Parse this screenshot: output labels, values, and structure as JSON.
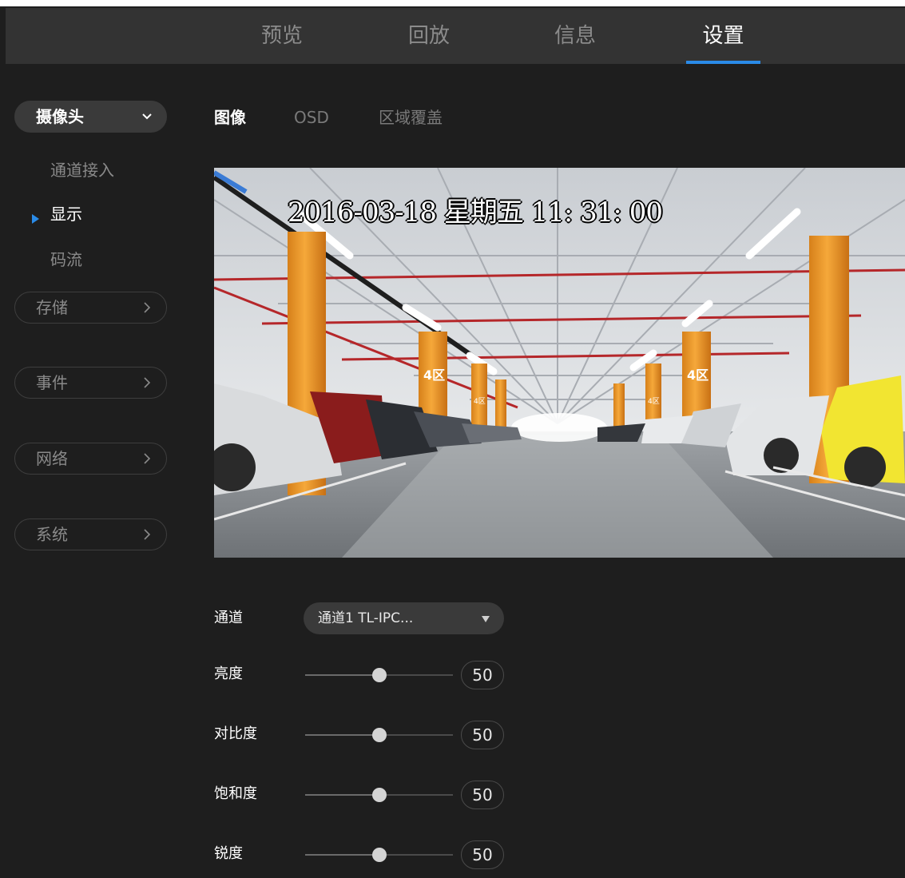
{
  "nav": {
    "tabs": [
      {
        "label": "预览",
        "active": false
      },
      {
        "label": "回放",
        "active": false
      },
      {
        "label": "信息",
        "active": false
      },
      {
        "label": "设置",
        "active": true
      }
    ],
    "accent_color": "#2a8be8"
  },
  "sidebar": {
    "camera": {
      "label": "摄像头",
      "expanded": true,
      "items": [
        {
          "label": "通道接入",
          "active": false
        },
        {
          "label": "显示",
          "active": true
        },
        {
          "label": "码流",
          "active": false
        }
      ]
    },
    "groups": [
      {
        "label": "存储"
      },
      {
        "label": "事件"
      },
      {
        "label": "网络"
      },
      {
        "label": "系统"
      }
    ]
  },
  "sub_tabs": [
    {
      "label": "图像",
      "active": true
    },
    {
      "label": "OSD",
      "active": false
    },
    {
      "label": "区域覆盖",
      "active": false
    }
  ],
  "preview": {
    "osd_datetime": "2016-03-18 星期五 11: 31: 00",
    "zone_labels": [
      "4区",
      "4区",
      "4区",
      "4区"
    ]
  },
  "form": {
    "channel": {
      "label": "通道",
      "value": "通道1 TL-IPC..."
    },
    "sliders": [
      {
        "label": "亮度",
        "value": "50",
        "max": 100
      },
      {
        "label": "对比度",
        "value": "50",
        "max": 100
      },
      {
        "label": "饱和度",
        "value": "50",
        "max": 100
      },
      {
        "label": "锐度",
        "value": "50",
        "max": 100
      }
    ]
  }
}
